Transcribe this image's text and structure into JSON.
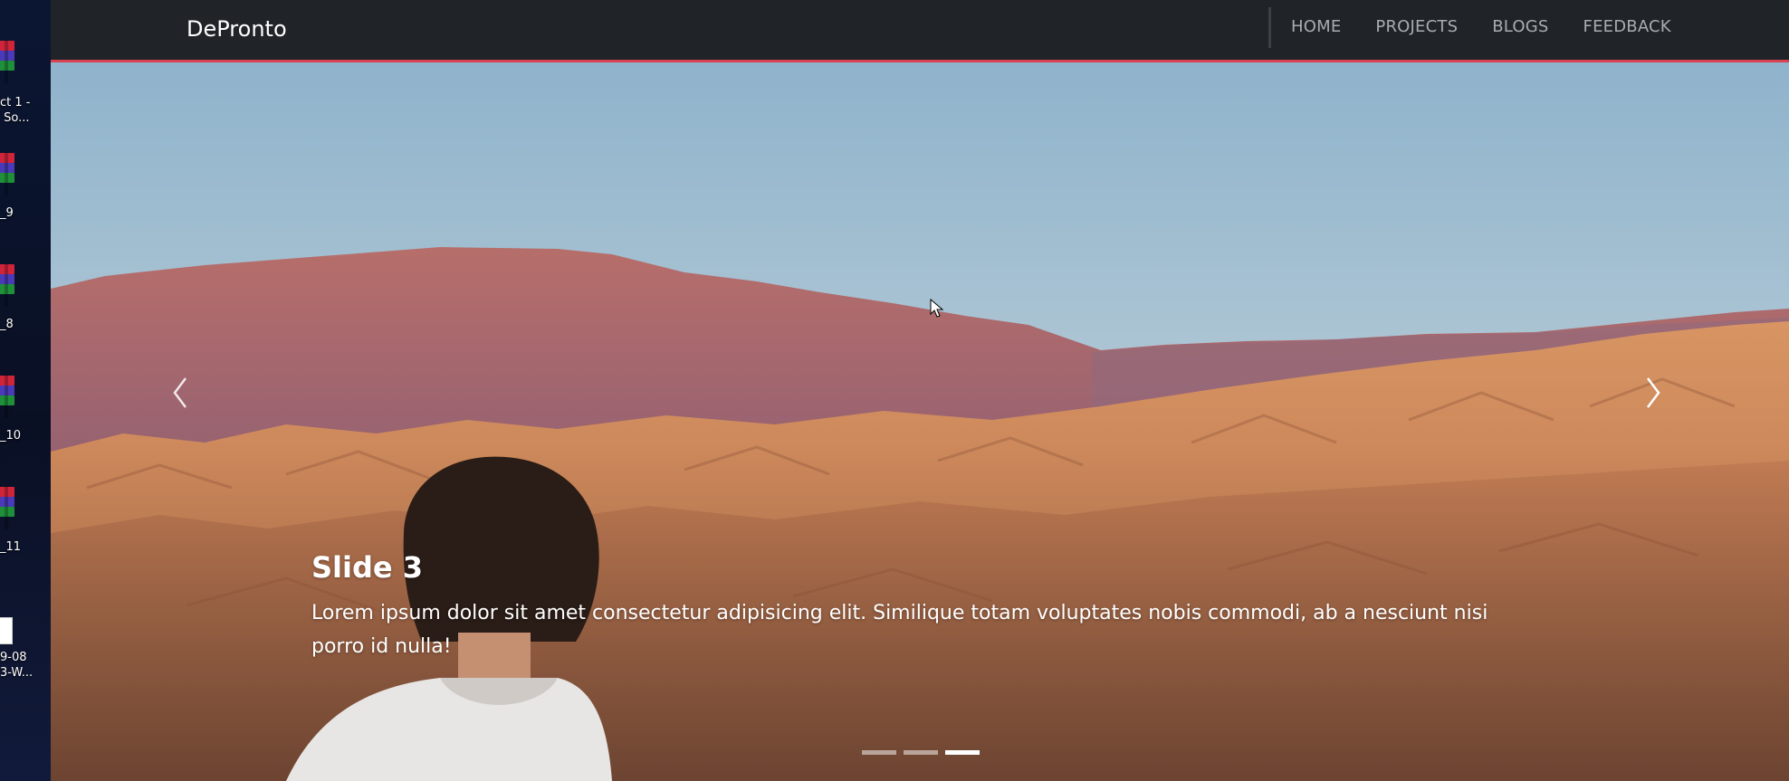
{
  "desktop": {
    "items": [
      {
        "icon": "winrar-archive-icon",
        "label": "ct 1 -\n So..."
      },
      {
        "icon": "winrar-archive-icon",
        "label": "_9"
      },
      {
        "icon": "winrar-archive-icon",
        "label": "_8"
      },
      {
        "icon": "winrar-archive-icon",
        "label": "_10"
      },
      {
        "icon": "winrar-archive-icon",
        "label": "_11"
      },
      {
        "icon": "document-icon",
        "label": "9-08\n3-W..."
      }
    ]
  },
  "navbar": {
    "brand": "DePronto",
    "links": [
      "HOME",
      "PROJECTS",
      "BLOGS",
      "FEEDBACK"
    ],
    "accent_color": "#d74350",
    "background_color": "#202327"
  },
  "carousel": {
    "image": "desert-mountains-person-photo",
    "caption_title": "Slide 3",
    "caption_text": "Lorem ipsum dolor sit amet consectetur adipisicing elit. Similique totam voluptates nobis commodi, ab a nesciunt nisi porro id nulla!",
    "prev_icon": "chevron-left-icon",
    "next_icon": "chevron-right-icon",
    "slide_count": 3,
    "active_slide": 3
  }
}
